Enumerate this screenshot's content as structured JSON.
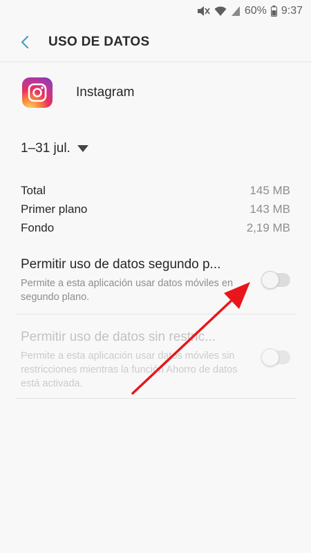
{
  "status_bar": {
    "battery": "60%",
    "time": "9:37",
    "icons": [
      "mute-icon",
      "wifi-icon",
      "signal-icon",
      "battery-icon"
    ]
  },
  "header": {
    "back_icon": "chevron-left-icon",
    "title": "USO DE DATOS"
  },
  "app": {
    "name": "Instagram",
    "icon": "instagram-icon"
  },
  "period": {
    "label": "1–31 jul.",
    "icon": "caret-down-icon"
  },
  "stats": [
    {
      "label": "Total",
      "value": "145 MB"
    },
    {
      "label": "Primer plano",
      "value": "143 MB"
    },
    {
      "label": "Fondo",
      "value": "2,19 MB"
    }
  ],
  "options": [
    {
      "title": "Permitir uso de datos segundo p...",
      "description": "Permite a esta aplicación usar datos móviles en segundo plano.",
      "enabled": true,
      "checked": false
    },
    {
      "title": "Permitir uso de datos sin restric...",
      "description": "Permite a esta aplicación usar datos móviles sin restricciones mientras la función Ahorro de datos está activada.",
      "enabled": false,
      "checked": false
    }
  ],
  "colors": {
    "accent": "#4a9bc4",
    "annotation_arrow": "#e8161b",
    "background": "#f8f8f8"
  }
}
